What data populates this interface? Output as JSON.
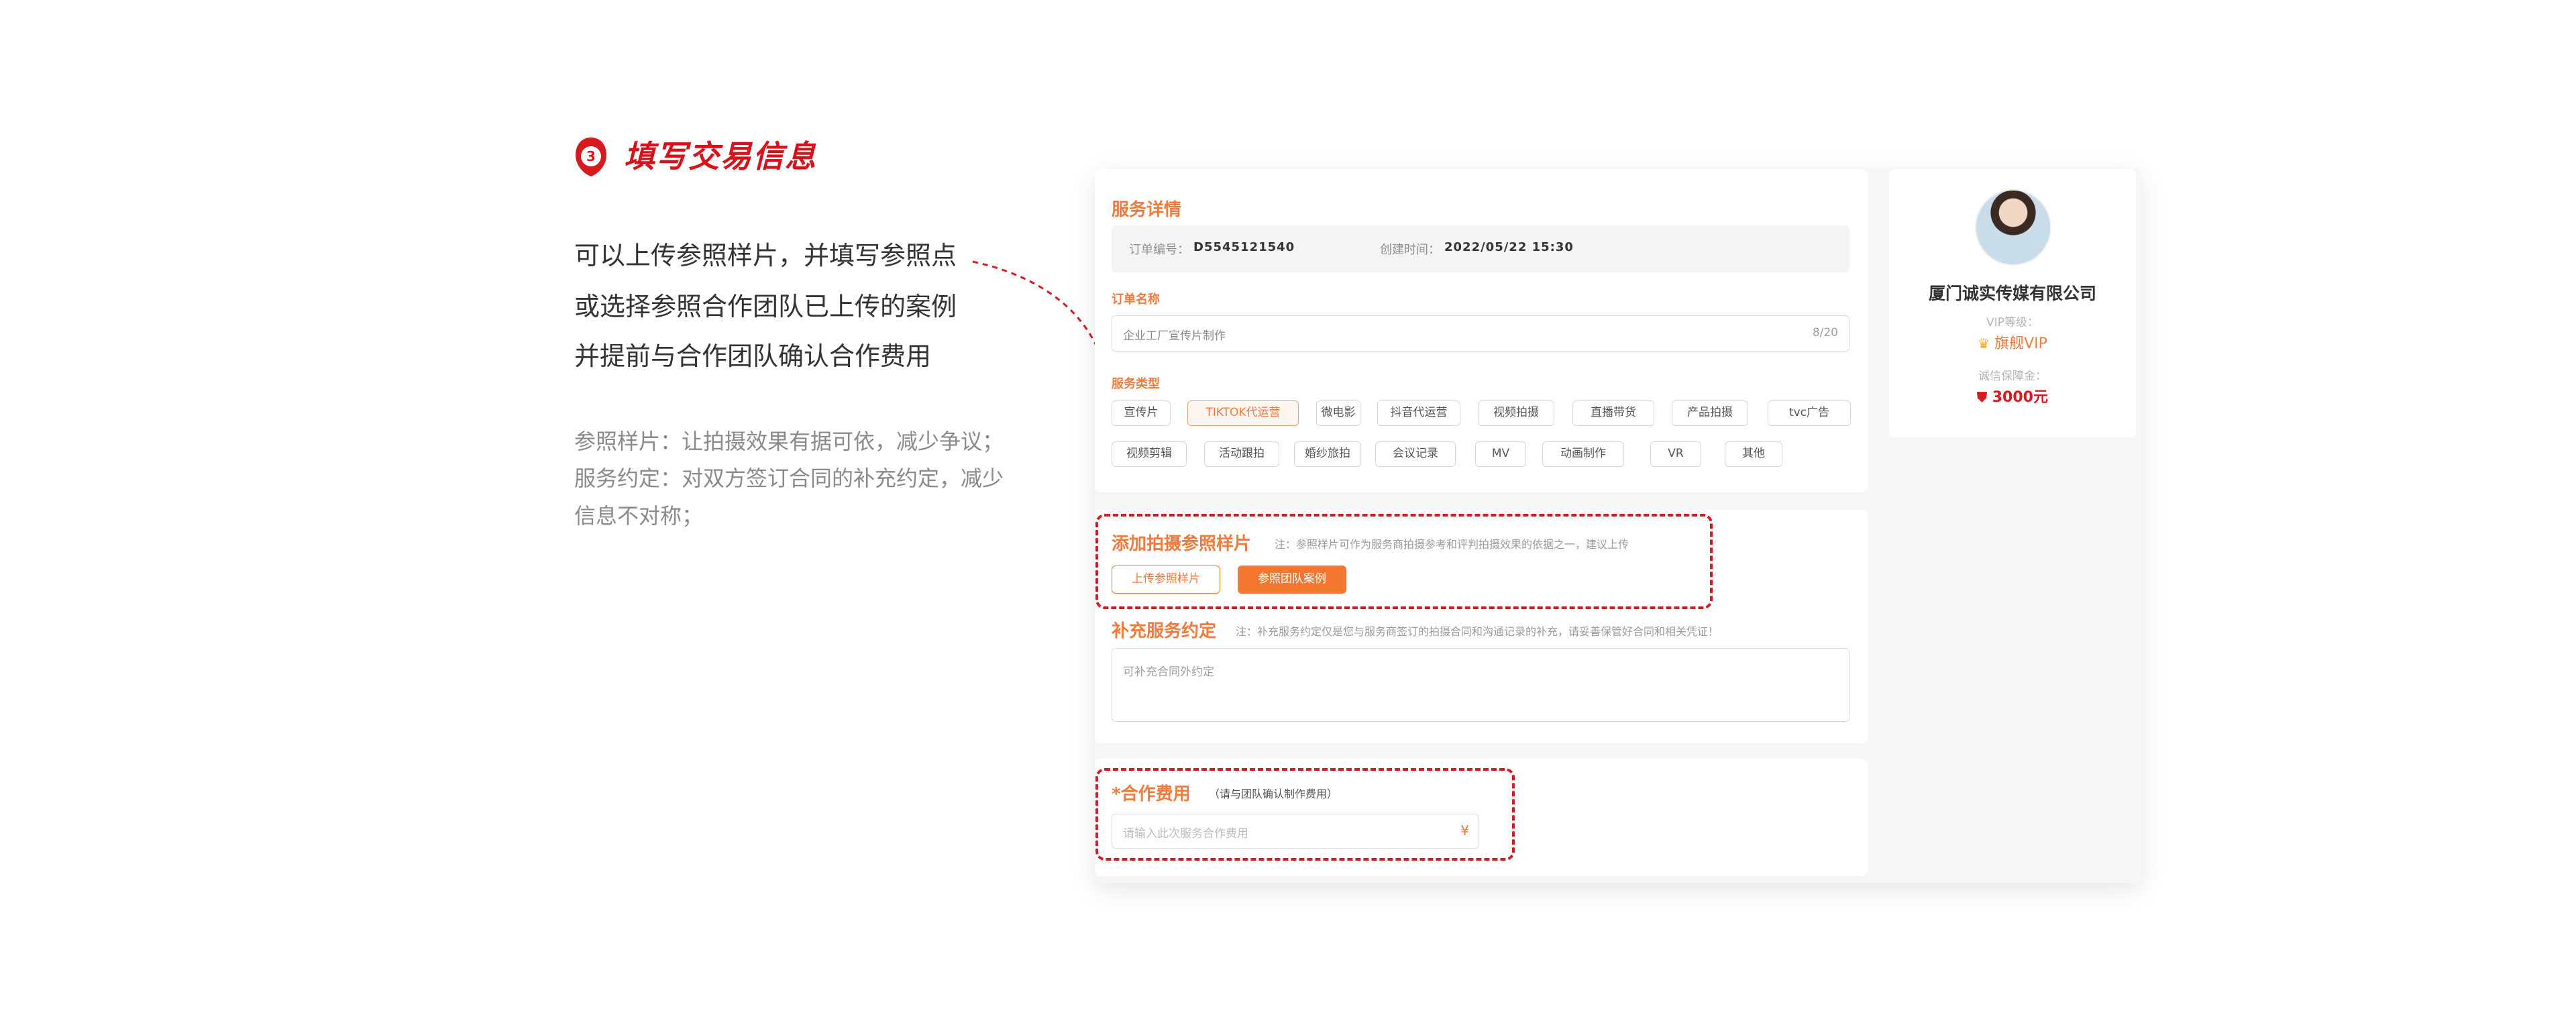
{
  "step": {
    "number": "3",
    "title": "填写交易信息"
  },
  "description": {
    "lines": [
      "可以上传参照样片，并填写参照点",
      "或选择参照合作团队已上传的案例",
      "并提前与合作团队确认合作费用"
    ],
    "notes": [
      "参照样片：让拍摄效果有据可依，减少争议；",
      "服务约定：对双方签订合同的补充约定，减少",
      "信息不对称；"
    ]
  },
  "service_detail": {
    "title": "服务详情",
    "order_no_label": "订单编号：",
    "order_no": "D5545121540",
    "created_label": "创建时间：",
    "created_time": "2022/05/22 15:30",
    "order_name_label": "订单名称",
    "order_name_value": "企业工厂宣传片制作",
    "order_name_count": "8/20",
    "service_type_label": "服务类型",
    "service_types_row1": [
      "宣传片",
      "TIKTOK代运营",
      "微电影",
      "抖音代运营",
      "视频拍摄",
      "直播带货",
      "产品拍摄",
      "tvc广告"
    ],
    "service_types_row2": [
      "视频剪辑",
      "活动跟拍",
      "婚纱旅拍",
      "会议记录",
      "MV",
      "动画制作",
      "VR",
      "其他"
    ],
    "active_type": "TIKTOK代运营"
  },
  "reference": {
    "title": "添加拍摄参照样片",
    "hint": "注：参照样片可作为服务商拍摄参考和评判拍摄效果的依据之一，建议上传",
    "upload_button": "上传参照样片",
    "case_button": "参照团队案例"
  },
  "agreement": {
    "title": "补充服务约定",
    "hint": "注：补充服务约定仅是您与服务商签订的拍摄合同和沟通记录的补充，请妥善保管好合同和相关凭证！",
    "placeholder": "可补充合同外约定"
  },
  "fee": {
    "title": "*合作费用",
    "subtitle": "（请与团队确认制作费用）",
    "placeholder": "请输入此次服务合作费用",
    "currency": "¥"
  },
  "provider": {
    "company": "厦门诚实传媒有限公司",
    "vip_label": "VIP等级：",
    "vip_value": "旗舰VIP",
    "deposit_label": "诚信保障金：",
    "deposit_value": "3000元"
  },
  "colors": {
    "accent": "#f27a3a",
    "highlight": "#d71a1f"
  }
}
